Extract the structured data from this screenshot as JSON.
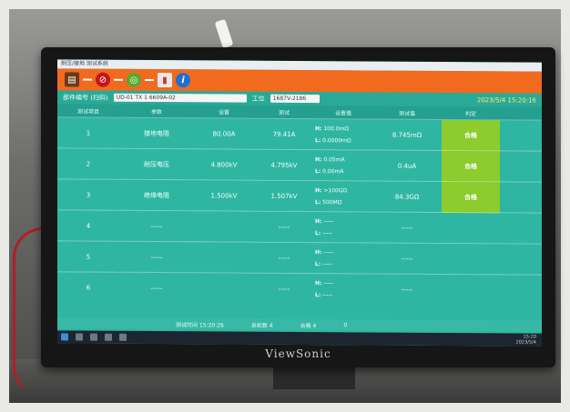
{
  "monitor_brand": "ViewSonic",
  "app": {
    "title": "耐压/接地 测试系统",
    "toolbar_icons": [
      "panel-icon",
      "stop-icon",
      "connect-icon",
      "export-icon",
      "info-icon"
    ]
  },
  "filter": {
    "label_part": "部件编号 (扫码)",
    "part_value": "UD-01 TX 1 6609A-02",
    "label_station": "工位",
    "station_value": "1687V-2186",
    "datetime": "2023/5/4 15:20:16"
  },
  "table": {
    "headers": [
      "测试项目",
      "参数",
      "设置",
      "测试",
      "设置值",
      "测试值",
      "判定"
    ],
    "rows": [
      {
        "no": "1",
        "item": "接地电阻",
        "set": "80.00A",
        "meas": "79.41A",
        "hi": "100.0mΩ",
        "lo": "0.0000mΩ",
        "value": "8.745mΩ",
        "result": "合格"
      },
      {
        "no": "2",
        "item": "耐压电压",
        "set": "4.800kV",
        "meas": "4.795kV",
        "hi": "0.05mA",
        "lo": "0.00mA",
        "value": "0.4uA",
        "result": "合格"
      },
      {
        "no": "3",
        "item": "绝缘电阻",
        "set": "1.500kV",
        "meas": "1.507kV",
        "hi": ">100GΩ",
        "lo": "500MΩ",
        "value": "84.3GΩ",
        "result": "合格"
      },
      {
        "no": "4",
        "item": "-----",
        "set": "",
        "meas": "-----",
        "hi": "-----",
        "lo": "-----",
        "value": "-----",
        "result": ""
      },
      {
        "no": "5",
        "item": "-----",
        "set": "",
        "meas": "-----",
        "hi": "-----",
        "lo": "-----",
        "value": "-----",
        "result": ""
      },
      {
        "no": "6",
        "item": "-----",
        "set": "",
        "meas": "-----",
        "hi": "-----",
        "lo": "-----",
        "value": "-----",
        "result": ""
      }
    ],
    "hi_label": "H:",
    "lo_label": "L:"
  },
  "summary": {
    "time": "测试时间 15:20:26",
    "total": "总检数 4",
    "pass": "合格 4",
    "fail": "0"
  },
  "taskbar": {
    "time": "15:20",
    "date": "2023/5/4"
  }
}
